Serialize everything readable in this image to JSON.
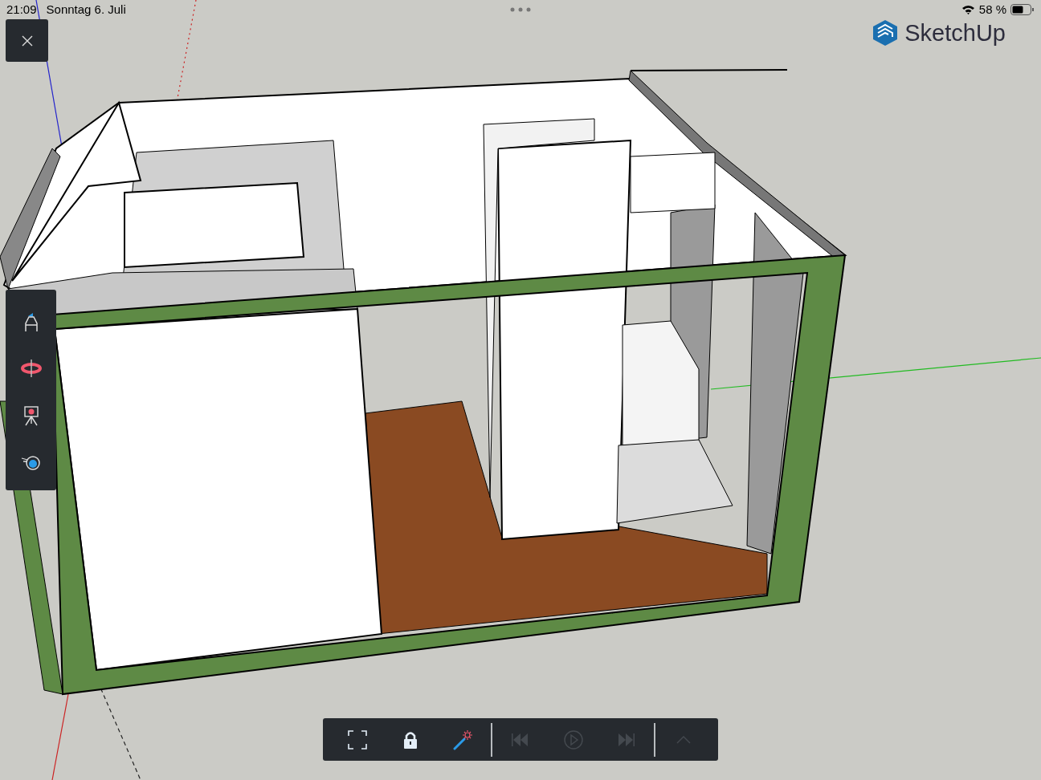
{
  "status_bar": {
    "time": "21:09",
    "date": "Sonntag 6. Juli",
    "battery_percent": "58 %"
  },
  "logo": {
    "text": "SketchUp"
  },
  "side_toolbar": [
    {
      "kind": "pencil"
    },
    {
      "kind": "orbit"
    },
    {
      "kind": "camera"
    },
    {
      "kind": "eye"
    }
  ],
  "bottom_toolbar": [
    [
      {
        "kind": "fullscreen",
        "disabled": false
      },
      {
        "kind": "lock",
        "disabled": false
      },
      {
        "kind": "wand",
        "disabled": false
      }
    ],
    [
      {
        "kind": "previous",
        "disabled": true
      },
      {
        "kind": "play",
        "disabled": true
      },
      {
        "kind": "next",
        "disabled": true
      }
    ],
    [
      {
        "kind": "expand",
        "disabled": true
      }
    ]
  ]
}
